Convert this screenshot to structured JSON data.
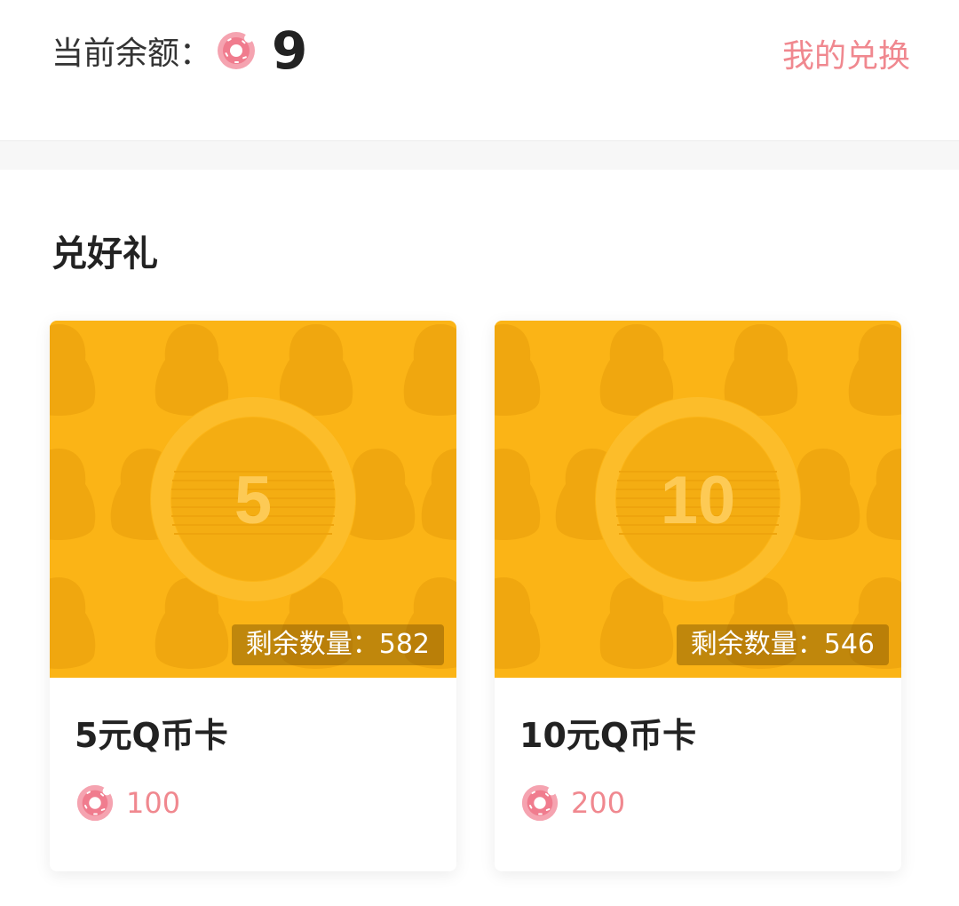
{
  "header": {
    "balance_label": "当前余额：",
    "balance_value": "9",
    "my_exchange_label": "我的兑换"
  },
  "section": {
    "title": "兑好礼"
  },
  "products": [
    {
      "face_value": "5",
      "stock_label": "剩余数量：",
      "stock_value": "582",
      "name": "5元Q币卡",
      "price": "100"
    },
    {
      "face_value": "10",
      "stock_label": "剩余数量：",
      "stock_value": "546",
      "name": "10元Q币卡",
      "price": "200"
    }
  ],
  "colors": {
    "accent": "#f0888f",
    "card_bg": "#fbb416",
    "card_pattern": "#f0a70f"
  },
  "icons": {
    "currency": "donut-icon"
  }
}
